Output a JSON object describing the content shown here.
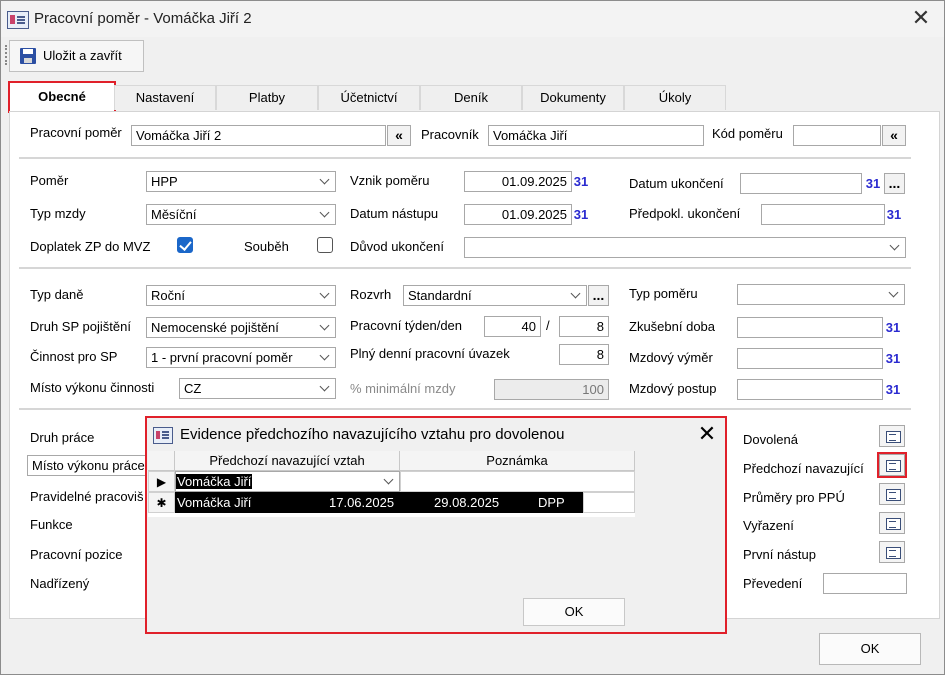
{
  "window": {
    "title": "Pracovní poměr - Vomáčka Jiří 2"
  },
  "toolbar": {
    "save_close": "Uložit a zavřít"
  },
  "tabs": [
    "Obecné",
    "Nastavení",
    "Platby",
    "Účetnictví",
    "Deník",
    "Dokumenty",
    "Úkoly"
  ],
  "header": {
    "pracovni_pomer_label": "Pracovní poměr",
    "pracovni_pomer_value": "Vomáčka Jiří 2",
    "pracovnik_label": "Pracovník",
    "pracovnik_value": "Vomáčka Jiří",
    "kod_pomeru_label": "Kód poměru",
    "kod_pomeru_value": "",
    "collapse_symbol": "«"
  },
  "section1": {
    "pomer_label": "Poměr",
    "pomer_value": "HPP",
    "typ_mzdy_label": "Typ mzdy",
    "typ_mzdy_value": "Měsíční",
    "doplatek_label": "Doplatek ZP do MVZ",
    "doplatek_checked": true,
    "soubeh_label": "Souběh",
    "soubeh_checked": false,
    "vznik_label": "Vznik poměru",
    "vznik_value": "01.09.2025",
    "nastup_label": "Datum nástupu",
    "nastup_value": "01.09.2025",
    "duvod_label": "Důvod ukončení",
    "duvod_value": "",
    "ukonceni_label": "Datum ukončení",
    "ukonceni_value": "",
    "predpokl_label": "Předpokl. ukončení",
    "predpokl_value": "",
    "calendar_symbol": "31",
    "ellipsis": "..."
  },
  "section2": {
    "typ_dane_label": "Typ daně",
    "typ_dane_value": "Roční",
    "druh_sp_label": "Druh SP pojištění",
    "druh_sp_value": "Nemocenské pojištění",
    "cinnost_label": "Činnost pro SP",
    "cinnost_value": "1 - první pracovní poměr",
    "misto_label": "Místo výkonu činnosti",
    "misto_value": "CZ",
    "rozvrh_label": "Rozvrh",
    "rozvrh_value": "Standardní",
    "tyden_label": "Pracovní týden/den",
    "tyden_value": "40",
    "tyden_sep": "/",
    "den_value": "8",
    "uvazek_label": "Plný denní pracovní úvazek",
    "uvazek_value": "8",
    "minimalni_label": "% minimální mzdy",
    "minimalni_value": "100",
    "typ_pomeru_label": "Typ poměru",
    "typ_pomeru_value": "",
    "zkusebni_label": "Zkušební doba",
    "vymer_label": "Mzdový výměr",
    "postup_label": "Mzdový postup"
  },
  "section3": {
    "druh_prace_label": "Druh práce",
    "misto_vykonu_prace_value": "Místo výkonu práce",
    "pravidelne_label": "Pravidelné pracoviš",
    "funkce_label": "Funkce",
    "pozice_label": "Pracovní pozice",
    "nadrizeny_label": "Nadřízený",
    "dovolena_label": "Dovolená",
    "predchozi_label": "Předchozí navazující",
    "prumery_label": "Průměry pro PPÚ",
    "vyrazeni_label": "Vyřazení",
    "prvni_nastup_label": "První nástup",
    "prevedeni_label": "Převedení",
    "prevedeni_value": ""
  },
  "ok_label": "OK",
  "dialog": {
    "title": "Evidence předchozího navazujícího vztahu pro dovolenou",
    "columns": [
      "Předchozí navazující vztah",
      "Poznámka"
    ],
    "row1": {
      "selector": "▶",
      "value": "Vomáčka Jiří",
      "note": ""
    },
    "row2": {
      "selector": "✱",
      "name": "Vomáčka Jiří",
      "from": "17.06.2025",
      "to": "29.08.2025",
      "type": "DPP"
    },
    "ok_label": "OK"
  }
}
